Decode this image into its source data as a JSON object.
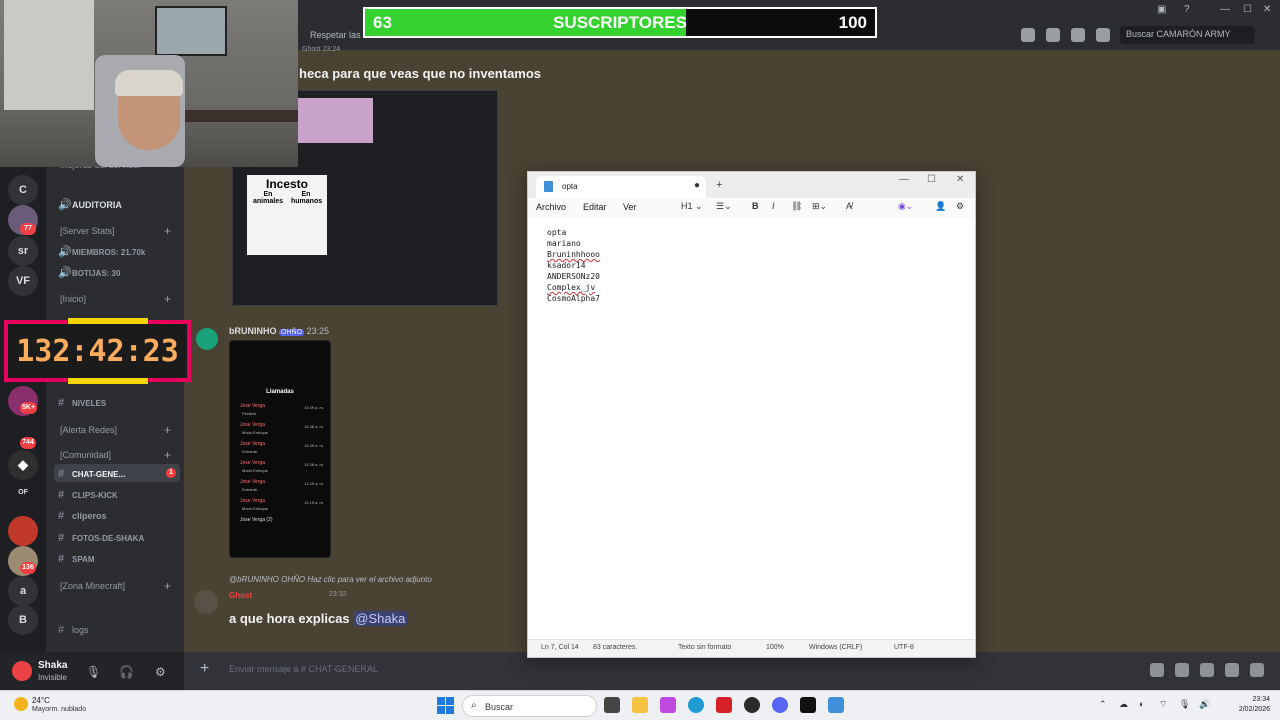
{
  "topbar": {
    "pinned_text": "Respetar las re",
    "search_placeholder": "Buscar CAMARÓN ARMY"
  },
  "subs_bar": {
    "current": "63",
    "label": "SUSCRIPTORES",
    "goal": "100",
    "progress": 0.63
  },
  "rail": {
    "servers": [
      {
        "label": "C"
      },
      {
        "label": "sr"
      },
      {
        "label": "VF"
      },
      {
        "label": "a"
      },
      {
        "label": "B"
      }
    ],
    "badges": [
      "77",
      "5K+",
      "744",
      "136"
    ],
    "small_labels": [
      "OF"
    ]
  },
  "sidebar": {
    "top_item": "Mejoras del servidor",
    "auditoria": "AUDITORIA",
    "cat_server_stats": "[Server Stats]",
    "members": "MIEMBROS: 21.70k",
    "bots": "BOTIJAS: 30",
    "cat_inicio": "[Inicio]",
    "niveles": "NIVELES",
    "cat_alerta": "[Alerta Redes]",
    "cat_comunidad": "[Comunidad]",
    "channels": [
      {
        "label": "CHAT-GENE...",
        "badge": "1"
      },
      {
        "label": "CLIPS-KICK"
      },
      {
        "label": "cliperos"
      },
      {
        "label": "FOTOS-DE-SHAKA"
      },
      {
        "label": "SPAM"
      }
    ],
    "cat_minecraft": "[Zona Minecraft]",
    "logs": "logs"
  },
  "user_panel": {
    "name": "Shaka",
    "status": "Invisible"
  },
  "timer": {
    "value": "132:42:23"
  },
  "messages": {
    "m1_author_time": "Ghost  23:24",
    "m1_text": "heca para que veas que no inventamos",
    "incesto_title": "Incesto",
    "incesto_left": "En animales",
    "incesto_right": "En humanos",
    "m2_author": "bRUNINHO",
    "m2_tag": "OHÑO",
    "m2_time": "23:25",
    "phone_title": "Llamadas",
    "calls": [
      {
        "name": "Jose Verga",
        "sub": "Perdida",
        "time": "11:49 a. m."
      },
      {
        "name": "Jose Verga",
        "sub": "Modo Enfoque",
        "time": "11:48 a. m."
      },
      {
        "name": "Jose Verga",
        "sub": "Entrante",
        "time": "11:39 a. m."
      },
      {
        "name": "Jose Verga",
        "sub": "Modo Enfoque",
        "time": "11:38 a. m."
      },
      {
        "name": "Jose Verga",
        "sub": "Entrante",
        "time": "11:25 a. m."
      },
      {
        "name": "Jose Verga",
        "sub": "Modo Enfoque",
        "time": "11:19 a. m."
      },
      {
        "name": "Jose Verga (2)",
        "sub": "",
        "time": ""
      }
    ],
    "reply_preview": "@bRUNINHO  OHÑO  Haz clic para ver el archivo adjunto",
    "m3_author": "Ghost",
    "m3_time": "23:32",
    "m3_text": "a que hora explicas ",
    "m3_mention": "@Shaka"
  },
  "composer": {
    "placeholder": "Enviar mensaje a #  CHAT-GENERAL"
  },
  "notepad": {
    "tab_title": "opta",
    "menu": [
      "Archivo",
      "Editar",
      "Ver"
    ],
    "heading_btn": "H1",
    "lines": [
      {
        "text": "opta",
        "spell": false
      },
      {
        "text": "mariano",
        "spell": false
      },
      {
        "text": "Bruninhhooo",
        "spell": true
      },
      {
        "text": "ksador14",
        "spell": false
      },
      {
        "text": "ANDERSONz20",
        "spell": false
      },
      {
        "text": "Complex_jv",
        "spell": true
      },
      {
        "text": "CosmoAlpha7",
        "spell": false
      }
    ],
    "status": {
      "position": "Ln 7, Col 14",
      "chars": "83 caracteres.",
      "format": "Texto sin formato",
      "zoom": "100%",
      "eol": "Windows (CRLF)",
      "encoding": "UTF-8"
    }
  },
  "taskbar": {
    "temperature": "24°C",
    "weather": "Mayorm. nublado",
    "search": "Buscar",
    "time": "23:34",
    "date": "2/02/2026"
  },
  "colors": {
    "accent_green": "#33d22e",
    "timer_border": "#e6005c",
    "timer_digits": "#ffad5c",
    "mention_bg": "#4a4233"
  }
}
